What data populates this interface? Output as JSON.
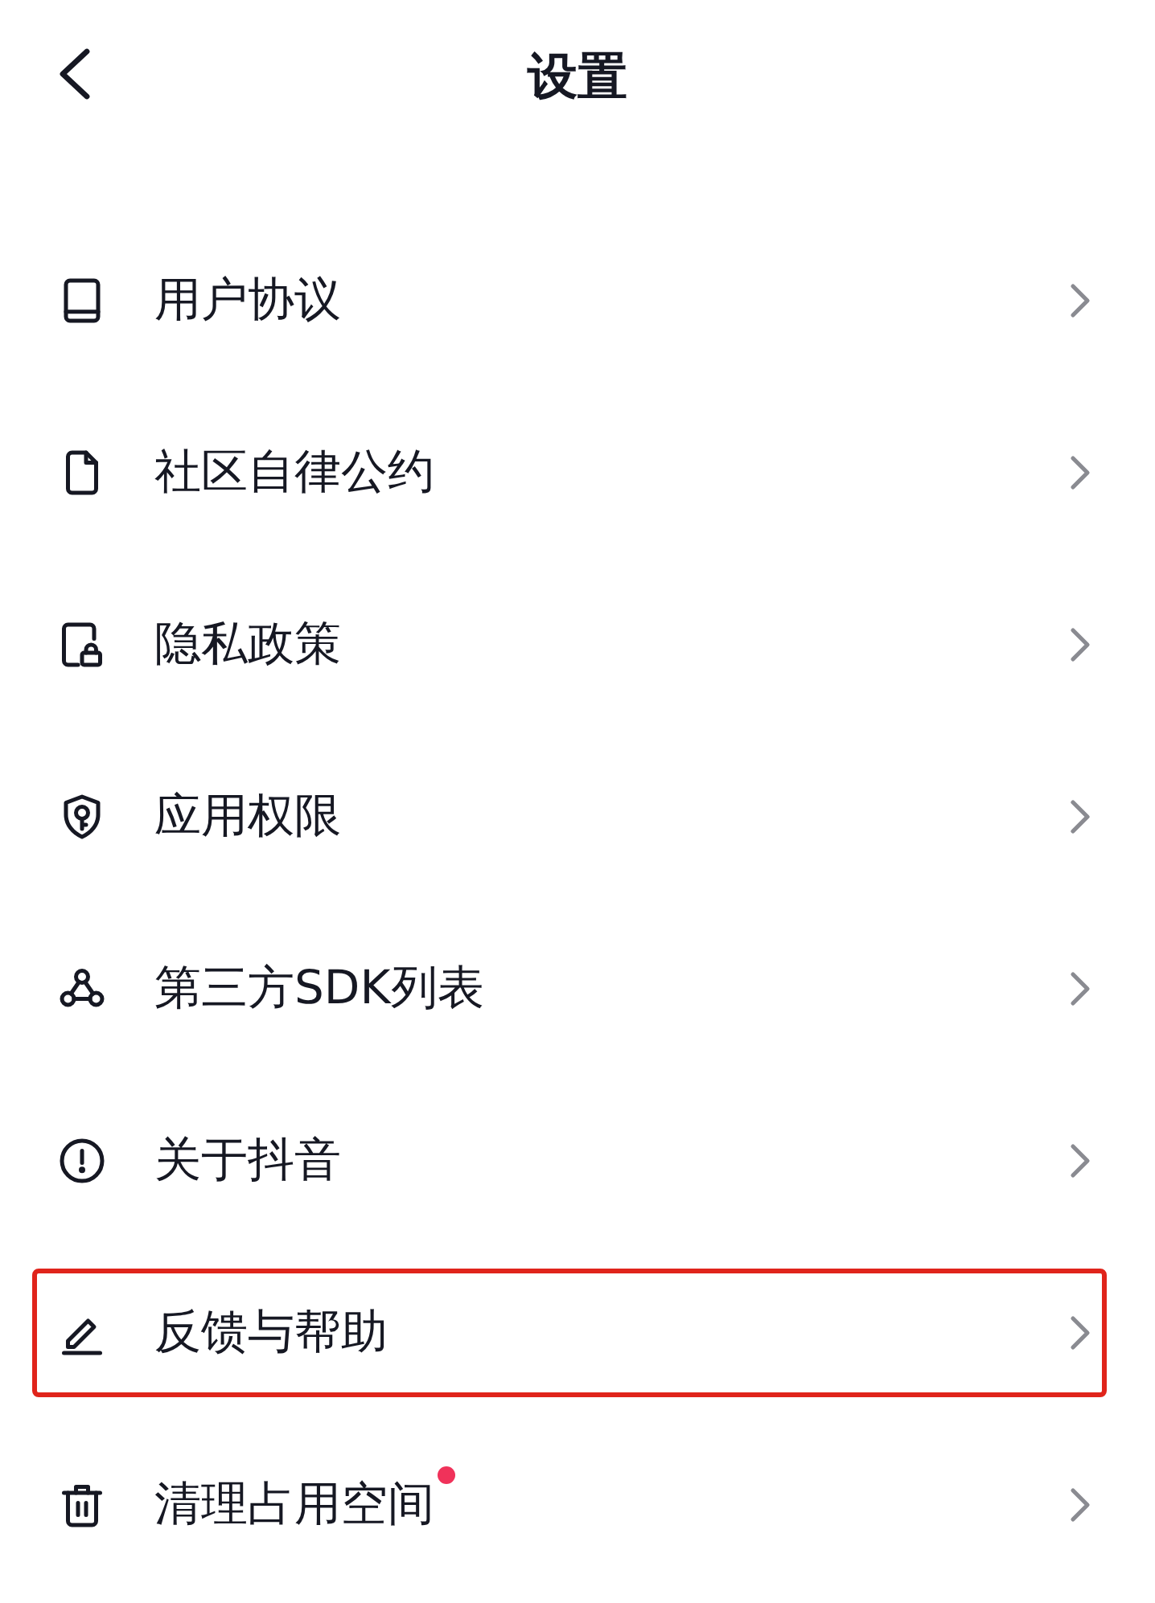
{
  "header": {
    "title": "设置"
  },
  "items": [
    {
      "label": "用户协议",
      "highlighted": false,
      "dot": false
    },
    {
      "label": "社区自律公约",
      "highlighted": false,
      "dot": false
    },
    {
      "label": "隐私政策",
      "highlighted": false,
      "dot": false
    },
    {
      "label": "应用权限",
      "highlighted": false,
      "dot": false
    },
    {
      "label": "第三方SDK列表",
      "highlighted": false,
      "dot": false
    },
    {
      "label": "关于抖音",
      "highlighted": false,
      "dot": false
    },
    {
      "label": "反馈与帮助",
      "highlighted": true,
      "dot": false
    },
    {
      "label": "清理占用空间",
      "highlighted": false,
      "dot": true,
      "color": "#f0325a"
    }
  ]
}
